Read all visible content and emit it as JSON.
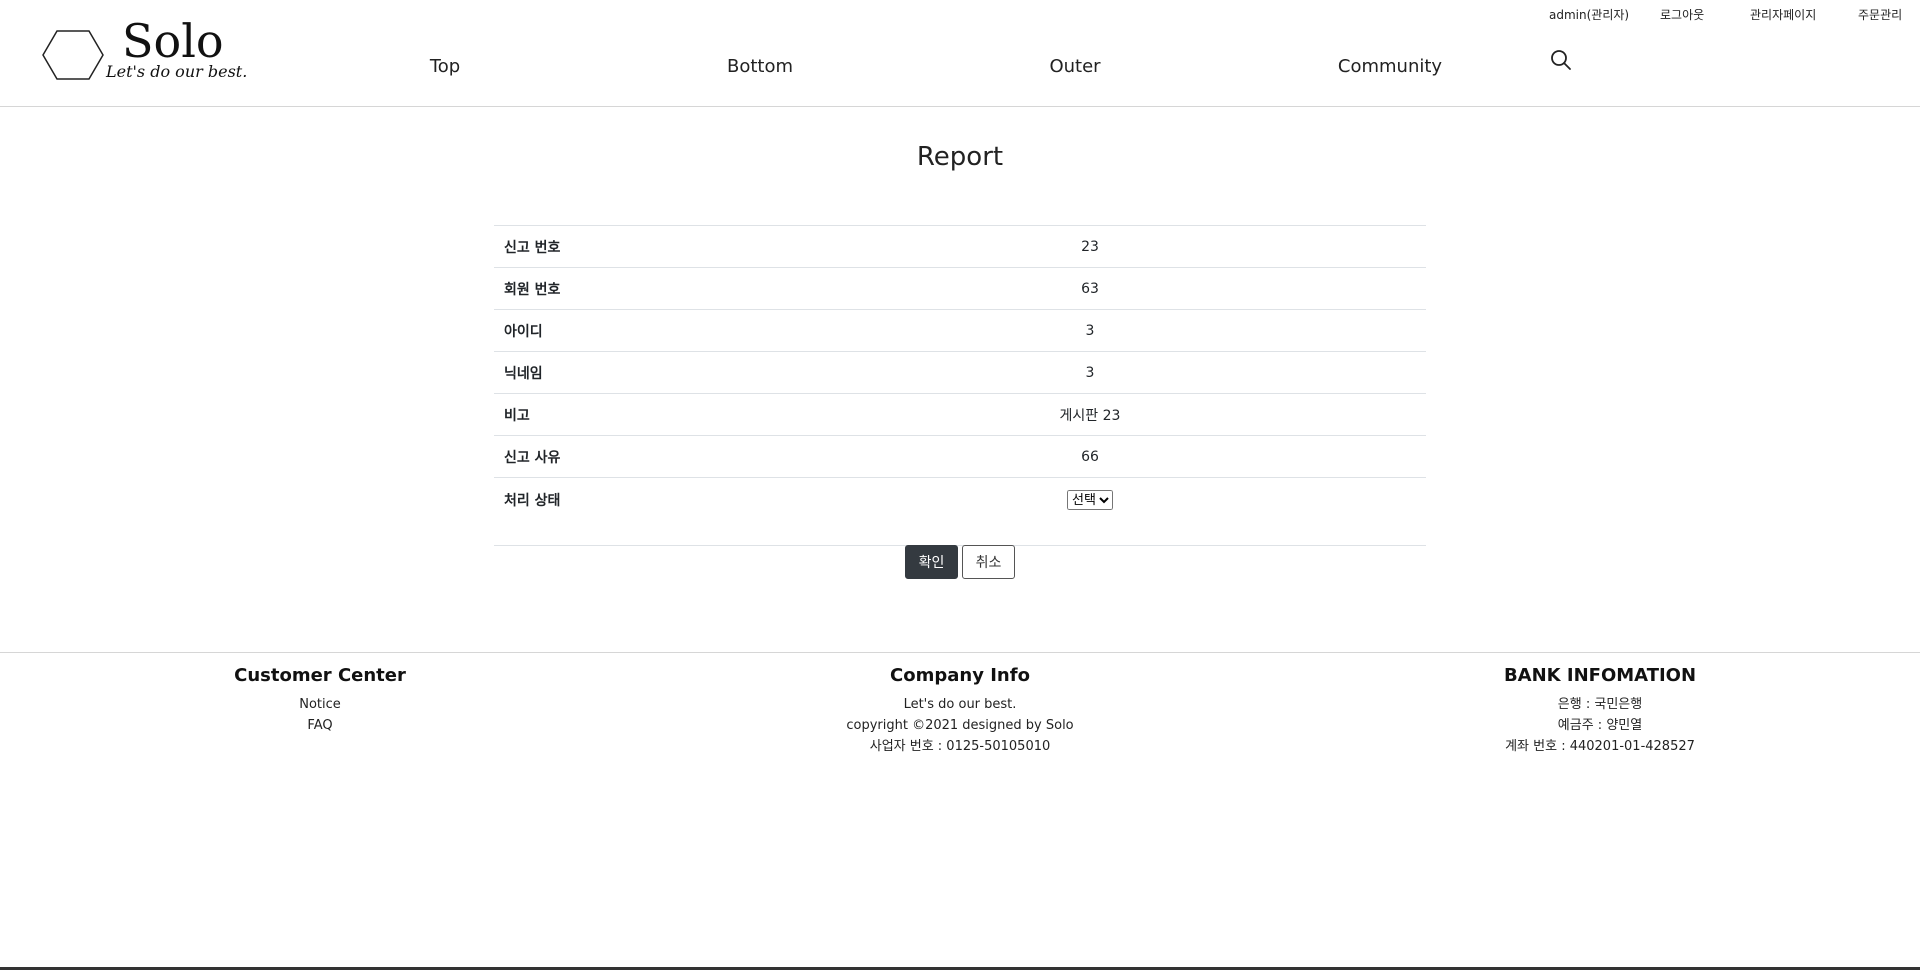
{
  "header": {
    "logo_title": "Solo",
    "logo_subtitle": "Let's do our best.",
    "nav": [
      "Top",
      "Bottom",
      "Outer",
      "Community"
    ],
    "util_links": {
      "user": "admin(관리자)",
      "logout": "로그아웃",
      "admin_page": "관리자페이지",
      "order_manage": "주문관리"
    }
  },
  "main": {
    "title": "Report",
    "rows": [
      {
        "label": "신고 번호",
        "value": "23"
      },
      {
        "label": "회원 번호",
        "value": "63"
      },
      {
        "label": "아이디",
        "value": "3"
      },
      {
        "label": "닉네임",
        "value": "3"
      },
      {
        "label": "비고",
        "value": "게시판 23"
      },
      {
        "label": "신고 사유",
        "value": "66"
      }
    ],
    "status": {
      "label": "처리 상태",
      "selected": "선택"
    },
    "buttons": {
      "confirm": "확인",
      "cancel": "취소"
    }
  },
  "footer": {
    "customer_center": {
      "title": "Customer Center",
      "links": [
        "Notice",
        "FAQ"
      ]
    },
    "company_info": {
      "title": "Company Info",
      "lines": [
        "Let's do our best.",
        "copyright ©2021 designed by Solo",
        "사업자 번호 : 0125-50105010"
      ]
    },
    "bank_info": {
      "title": "BANK INFOMATION",
      "lines": [
        "은행 : 국민은행",
        "예금주 : 양민열",
        "계좌 번호 : 440201-01-428527"
      ]
    }
  },
  "colors": {
    "confirm_button_bg": "#343a40",
    "divider": "#dee2e6"
  },
  "icons": {
    "search": "search-icon",
    "logo": "hexagon-logo-icon"
  }
}
